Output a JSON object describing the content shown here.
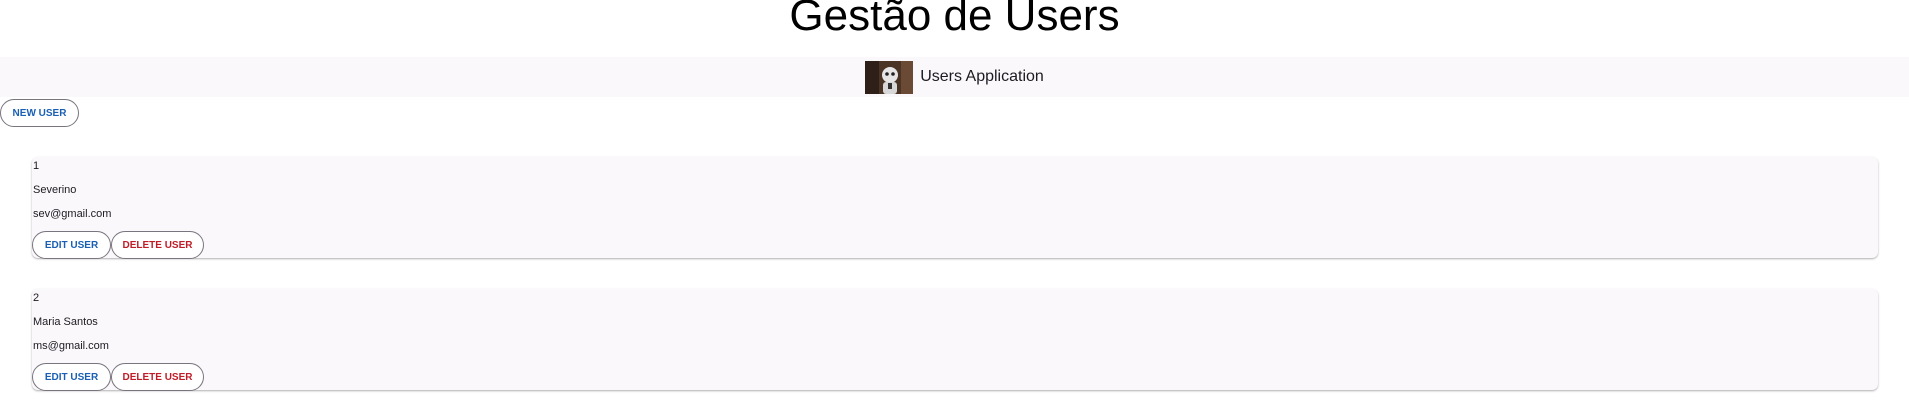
{
  "page_title": "Gestão de Users",
  "app_bar": {
    "logo_icon": "robot-avatar-logo",
    "app_name": "Users Application"
  },
  "toolbar": {
    "new_user_label": "New User"
  },
  "users": [
    {
      "id": "1",
      "name": "Severino",
      "email": "sev@gmail.com",
      "edit_label": "Edit User",
      "delete_label": "Delete User"
    },
    {
      "id": "2",
      "name": "Maria Santos",
      "email": "ms@gmail.com",
      "edit_label": "Edit User",
      "delete_label": "Delete User"
    }
  ],
  "colors": {
    "primary": "#1a5fb4",
    "danger": "#c01c28",
    "surface": "#fbf8fc",
    "outline": "#79747e"
  }
}
